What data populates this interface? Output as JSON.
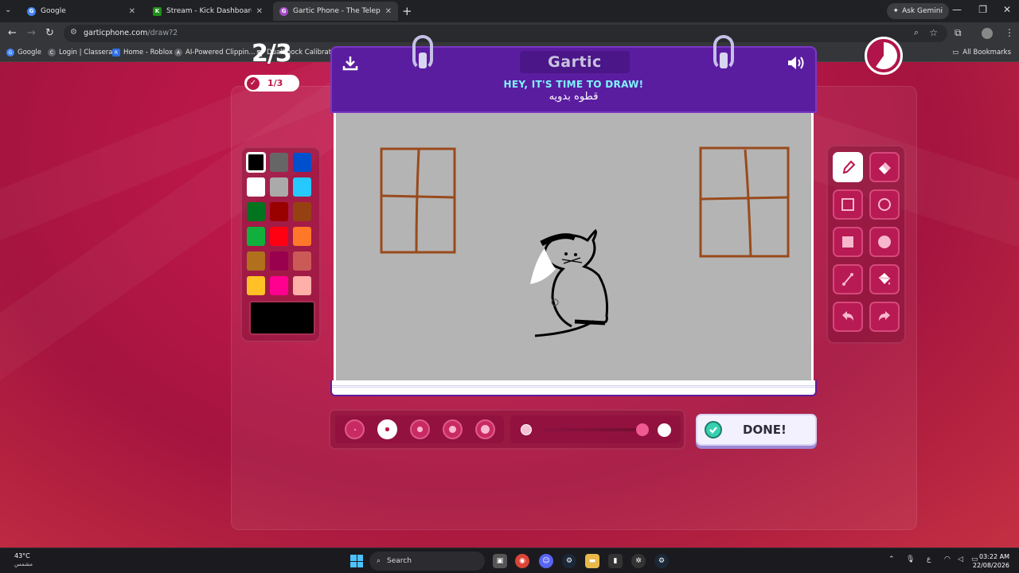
{
  "browser": {
    "tabs": [
      {
        "title": "Google",
        "favicon": "google-icon",
        "color": "#4285f4",
        "letter": "G",
        "active": false
      },
      {
        "title": "Stream - Kick Dashboard",
        "favicon": "kick-icon",
        "color": "#53fc18",
        "letter": "K",
        "active": false
      },
      {
        "title": "Gartic Phone - The Telephone G",
        "favicon": "gartic-icon",
        "color": "#a64cc7",
        "letter": "G",
        "active": true
      }
    ],
    "ask_gemini": "Ask Gemini",
    "url_host": "garticphone.com",
    "url_path": "/draw?2",
    "bookmarks": [
      {
        "label": "Google",
        "icon": "google-icon",
        "letter": "G"
      },
      {
        "label": "Login | Classera",
        "icon": "classera-icon",
        "letter": "C"
      },
      {
        "label": "Home - Roblox",
        "icon": "roblox-icon",
        "letter": "R"
      },
      {
        "label": "AI-Powered Clippin...",
        "icon": "clip-icon",
        "letter": "A"
      },
      {
        "label": "DualShock Calibrati...",
        "icon": "gamepad-icon",
        "letter": "D"
      }
    ],
    "all_bookmarks": "All Bookmarks"
  },
  "game": {
    "round": "2/3",
    "turn": "1/3",
    "logo": "Gartic",
    "prompt_title": "HEY, IT'S TIME TO DRAW!",
    "prompt_word": "قطوه بدويه",
    "done_label": "DONE!",
    "selected_color": "#000000",
    "colors": [
      [
        "#000000",
        "#666666",
        "#0050cd"
      ],
      [
        "#ffffff",
        "#aaaaaa",
        "#26c9ff"
      ],
      [
        "#017420",
        "#990000",
        "#964112"
      ],
      [
        "#11b03c",
        "#ff0013",
        "#ff7829"
      ],
      [
        "#b0701c",
        "#99004e",
        "#cb5a57"
      ],
      [
        "#ffc126",
        "#ff008f",
        "#feafa8"
      ]
    ],
    "tools": [
      {
        "name": "pen-tool",
        "icon": "pencil-icon",
        "active": true
      },
      {
        "name": "eraser-tool",
        "icon": "eraser-icon",
        "active": false
      },
      {
        "name": "rectangle-outline-tool",
        "icon": "square-outline-icon",
        "active": false
      },
      {
        "name": "ellipse-outline-tool",
        "icon": "circle-outline-icon",
        "active": false
      },
      {
        "name": "rectangle-fill-tool",
        "icon": "square-filled-icon",
        "active": false
      },
      {
        "name": "ellipse-fill-tool",
        "icon": "circle-filled-icon",
        "active": false
      },
      {
        "name": "line-tool",
        "icon": "line-icon",
        "active": false
      },
      {
        "name": "fill-bucket-tool",
        "icon": "paint-bucket-icon",
        "active": false
      },
      {
        "name": "undo-tool",
        "icon": "undo-icon",
        "active": false
      },
      {
        "name": "redo-tool",
        "icon": "redo-icon",
        "active": false
      }
    ],
    "brush_sizes": 5,
    "selected_brush_size": 2,
    "opacity_level": 0.93
  },
  "taskbar": {
    "temperature": "43°C",
    "condition": "مشمس",
    "search": "Search",
    "time": "03:22 AM",
    "date": "22/08/2026",
    "lang": "ع"
  }
}
